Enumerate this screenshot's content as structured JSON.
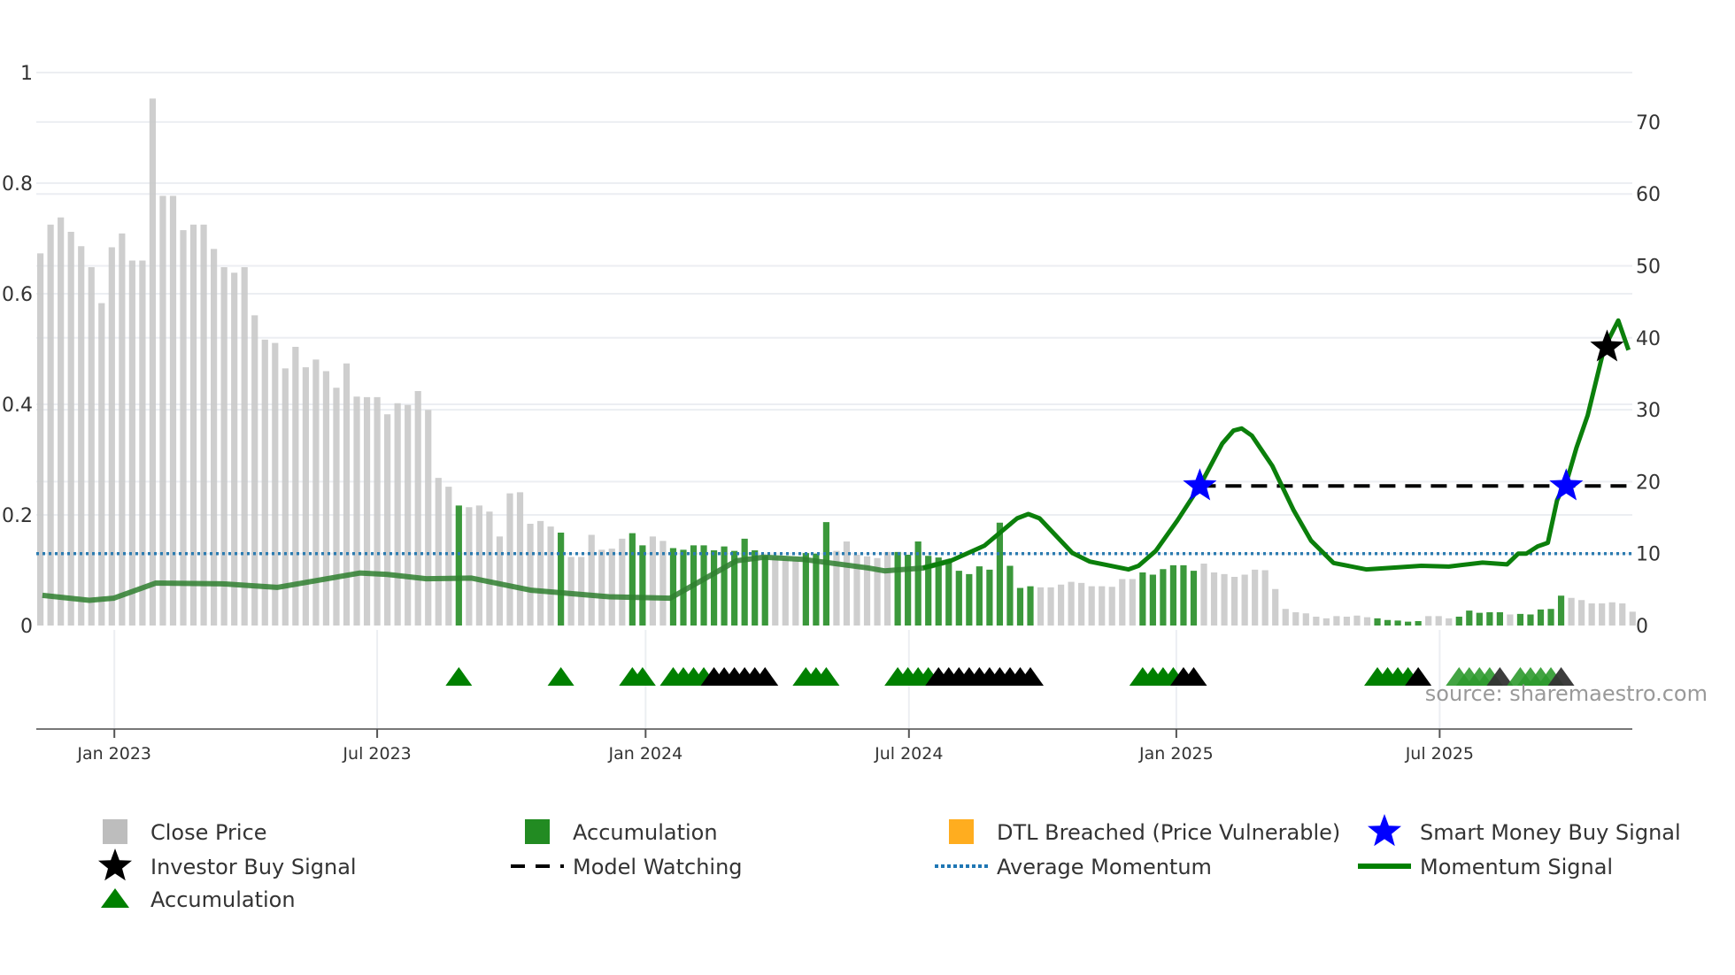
{
  "chart_data": {
    "type": "bar",
    "title": "",
    "source": "source: sharemaestro.com",
    "x_unit": "week index",
    "x_ticks": [
      {
        "label": "Jan 2023",
        "week": 7.25
      },
      {
        "label": "Jul 2023",
        "week": 33
      },
      {
        "label": "Jan 2024",
        "week": 59.3
      },
      {
        "label": "Jul 2024",
        "week": 85.1
      },
      {
        "label": "Jan 2025",
        "week": 111.3
      },
      {
        "label": "Jul 2025",
        "week": 137.1
      }
    ],
    "y_left": {
      "label": "",
      "lim": [
        0,
        1
      ],
      "ticks": [
        0,
        0.2,
        0.4,
        0.6,
        0.8,
        1
      ],
      "tick_labels": [
        "0",
        "0.2",
        "0.4",
        "0.6",
        "0.8",
        "1"
      ]
    },
    "y_right": {
      "label": "",
      "lim": [
        0,
        76.9
      ],
      "ticks": [
        0,
        10,
        20,
        30,
        40,
        50,
        60,
        70
      ],
      "tick_labels": [
        "0",
        "10",
        "20",
        "30",
        "40",
        "50",
        "60",
        "70"
      ]
    },
    "grid": true,
    "legend_position": "bottom",
    "close_price": [
      0.673,
      0.725,
      0.738,
      0.712,
      0.686,
      0.648,
      0.583,
      0.684,
      0.709,
      0.66,
      0.66,
      0.953,
      0.777,
      0.777,
      0.715,
      0.725,
      0.725,
      0.681,
      0.648,
      0.638,
      0.648,
      0.561,
      0.517,
      0.511,
      0.465,
      0.504,
      0.467,
      0.481,
      0.46,
      0.43,
      0.474,
      0.414,
      0.413,
      0.413,
      0.382,
      0.402,
      0.399,
      0.424,
      0.39,
      0.267,
      0.251,
      0.217,
      0.214,
      0.217,
      0.206,
      0.161,
      0.239,
      0.241,
      0.184,
      0.189,
      0.179,
      0.168,
      0.124,
      0.124,
      0.164,
      0.137,
      0.139,
      0.157,
      0.167,
      0.145,
      0.161,
      0.153,
      0.14,
      0.137,
      0.145,
      0.145,
      0.136,
      0.143,
      0.135,
      0.157,
      0.136,
      0.126,
      0.124,
      0.121,
      0.118,
      0.131,
      0.13,
      0.187,
      0.135,
      0.152,
      0.128,
      0.125,
      0.122,
      0.133,
      0.133,
      0.128,
      0.152,
      0.126,
      0.123,
      0.115,
      0.099,
      0.093,
      0.107,
      0.101,
      0.186,
      0.108,
      0.068,
      0.071,
      0.069,
      0.069,
      0.074,
      0.079,
      0.077,
      0.071,
      0.071,
      0.07,
      0.084,
      0.084,
      0.096,
      0.092,
      0.102,
      0.109,
      0.109,
      0.099,
      0.112,
      0.096,
      0.093,
      0.088,
      0.092,
      0.101,
      0.1,
      0.066,
      0.03,
      0.024,
      0.022,
      0.016,
      0.013,
      0.017,
      0.016,
      0.018,
      0.015,
      0.013,
      0.01,
      0.009,
      0.007,
      0.008,
      0.017,
      0.017,
      0.013,
      0.016,
      0.027,
      0.023,
      0.024,
      0.024,
      0.02,
      0.021,
      0.02,
      0.029,
      0.03,
      0.054,
      0.05,
      0.046,
      0.04,
      0.04,
      0.042,
      0.04,
      0.025
    ],
    "accumulation_weeks": [
      41,
      51,
      58,
      59,
      62,
      63,
      64,
      65,
      66,
      67,
      68,
      69,
      70,
      71,
      75,
      76,
      77,
      84,
      85,
      86,
      87,
      88,
      89,
      90,
      91,
      92,
      93,
      94,
      95,
      96,
      97,
      108,
      109,
      110,
      111,
      112,
      113,
      131,
      132,
      133,
      134,
      135,
      139,
      140,
      141,
      142,
      143,
      145,
      146,
      147,
      148,
      149
    ],
    "momentum": [
      [
        0.2,
        4.2
      ],
      [
        4.8,
        3.5
      ],
      [
        7.2,
        3.8
      ],
      [
        11.3,
        5.9
      ],
      [
        17.8,
        5.8
      ],
      [
        23.2,
        5.3
      ],
      [
        31.3,
        7.3
      ],
      [
        34,
        7.1
      ],
      [
        37.8,
        6.5
      ],
      [
        42.2,
        6.6
      ],
      [
        48.1,
        4.9
      ],
      [
        55.7,
        4.0
      ],
      [
        61.7,
        3.8
      ],
      [
        68.2,
        9.0
      ],
      [
        70.9,
        9.5
      ],
      [
        74.7,
        9.2
      ],
      [
        81.1,
        8.0
      ],
      [
        82.7,
        7.6
      ],
      [
        86.5,
        8.0
      ],
      [
        89.2,
        9.0
      ],
      [
        92.5,
        11.1
      ],
      [
        95.7,
        14.9
      ],
      [
        96.8,
        15.5
      ],
      [
        97.9,
        14.9
      ],
      [
        101.1,
        10.1
      ],
      [
        102.8,
        8.9
      ],
      [
        106.6,
        7.8
      ],
      [
        107.6,
        8.3
      ],
      [
        109.3,
        10.4
      ],
      [
        111.4,
        14.6
      ],
      [
        113.6,
        19.4
      ],
      [
        115.8,
        25.3
      ],
      [
        116.9,
        27.1
      ],
      [
        117.7,
        27.4
      ],
      [
        118.7,
        26.4
      ],
      [
        120.7,
        22.2
      ],
      [
        122.8,
        16.0
      ],
      [
        124.5,
        11.8
      ],
      [
        126.7,
        8.7
      ],
      [
        129.9,
        7.8
      ],
      [
        135.3,
        8.3
      ],
      [
        138,
        8.2
      ],
      [
        141.3,
        8.75
      ],
      [
        143.7,
        8.5
      ],
      [
        144.8,
        10.0
      ],
      [
        145.6,
        10.0
      ],
      [
        146.7,
        11.0
      ],
      [
        147.7,
        11.5
      ],
      [
        148.6,
        17.4
      ],
      [
        149.7,
        20.8
      ],
      [
        150.5,
        24.7
      ],
      [
        151.6,
        29.2
      ],
      [
        153.2,
        38.5
      ],
      [
        154.6,
        42.4
      ],
      [
        155.6,
        38.3
      ]
    ],
    "momentum_faded_until_week": 88,
    "average_momentum": 10,
    "model_watching": {
      "value": 19.4,
      "from_week": 113.6
    },
    "smart_money_buy_signals": [
      [
        113.6,
        19.4
      ],
      [
        149.5,
        19.4
      ]
    ],
    "investor_buy_signals": [
      [
        153.5,
        38.7
      ]
    ],
    "triangle_markers": [
      {
        "week": 41,
        "kind": "accumulation"
      },
      {
        "week": 51,
        "kind": "accumulation"
      },
      {
        "week": 58,
        "kind": "accumulation"
      },
      {
        "week": 59,
        "kind": "accumulation"
      },
      {
        "week": 62,
        "kind": "accumulation"
      },
      {
        "week": 63,
        "kind": "accumulation"
      },
      {
        "week": 64,
        "kind": "accumulation"
      },
      {
        "week": 65,
        "kind": "accumulation"
      },
      {
        "week": 66,
        "kind": "black"
      },
      {
        "week": 67,
        "kind": "black"
      },
      {
        "week": 68,
        "kind": "black"
      },
      {
        "week": 69,
        "kind": "black"
      },
      {
        "week": 70,
        "kind": "black"
      },
      {
        "week": 71,
        "kind": "black"
      },
      {
        "week": 75,
        "kind": "accumulation"
      },
      {
        "week": 76,
        "kind": "accumulation"
      },
      {
        "week": 77,
        "kind": "accumulation"
      },
      {
        "week": 84,
        "kind": "accumulation"
      },
      {
        "week": 85,
        "kind": "accumulation"
      },
      {
        "week": 86,
        "kind": "accumulation"
      },
      {
        "week": 87,
        "kind": "accumulation"
      },
      {
        "week": 88,
        "kind": "black"
      },
      {
        "week": 89,
        "kind": "black"
      },
      {
        "week": 90,
        "kind": "black"
      },
      {
        "week": 91,
        "kind": "black"
      },
      {
        "week": 92,
        "kind": "black"
      },
      {
        "week": 93,
        "kind": "black"
      },
      {
        "week": 94,
        "kind": "black"
      },
      {
        "week": 95,
        "kind": "black"
      },
      {
        "week": 96,
        "kind": "black"
      },
      {
        "week": 97,
        "kind": "black"
      },
      {
        "week": 108,
        "kind": "accumulation"
      },
      {
        "week": 109,
        "kind": "accumulation"
      },
      {
        "week": 110,
        "kind": "accumulation"
      },
      {
        "week": 111,
        "kind": "accumulation"
      },
      {
        "week": 112,
        "kind": "black"
      },
      {
        "week": 113,
        "kind": "black"
      },
      {
        "week": 131,
        "kind": "accumulation"
      },
      {
        "week": 132,
        "kind": "accumulation"
      },
      {
        "week": 133,
        "kind": "accumulation"
      },
      {
        "week": 134,
        "kind": "accumulation"
      },
      {
        "week": 135,
        "kind": "black"
      },
      {
        "week": 139,
        "kind": "light"
      },
      {
        "week": 140,
        "kind": "light"
      },
      {
        "week": 141,
        "kind": "light"
      },
      {
        "week": 142,
        "kind": "light"
      },
      {
        "week": 143,
        "kind": "dark"
      },
      {
        "week": 145,
        "kind": "light"
      },
      {
        "week": 146,
        "kind": "light"
      },
      {
        "week": 147,
        "kind": "light"
      },
      {
        "week": 148,
        "kind": "light"
      },
      {
        "week": 149,
        "kind": "dark"
      }
    ],
    "legend": [
      {
        "label": "Close Price",
        "symbol": "square",
        "color": "#bdbdbd"
      },
      {
        "label": "Accumulation",
        "symbol": "square",
        "color": "#228b22"
      },
      {
        "label": "DTL Breached (Price Vulnerable)",
        "symbol": "square",
        "color": "#ffad1f"
      },
      {
        "label": "Smart Money Buy Signal",
        "symbol": "star",
        "color": "#0000ff"
      },
      {
        "label": "Investor Buy Signal",
        "symbol": "star",
        "color": "#000000"
      },
      {
        "label": "Model Watching",
        "symbol": "dash",
        "color": "#000000"
      },
      {
        "label": "Average Momentum",
        "symbol": "dot",
        "color": "#1f77b4"
      },
      {
        "label": "Momentum Signal",
        "symbol": "line",
        "color": "#008000"
      },
      {
        "label": "Accumulation",
        "symbol": "triangle",
        "color": "#008000"
      }
    ]
  },
  "colors": {
    "bar_gray": "#c9c9c9",
    "bar_green": "#2a8f2a",
    "momentum": "#0b7f0b",
    "avg": "#2b7bb0",
    "grid": "#eceef2"
  }
}
